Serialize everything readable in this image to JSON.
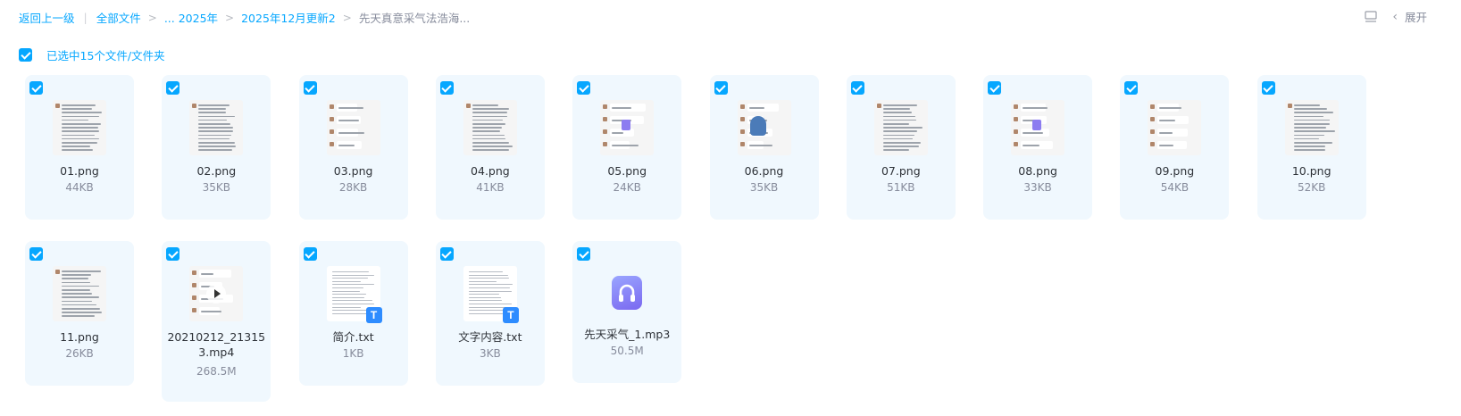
{
  "breadcrumb": {
    "back": "返回上一级",
    "items": [
      "全部文件",
      "... 2025年",
      "2025年12月更新2"
    ],
    "current": "先天真意采气法浩海..."
  },
  "toolbar": {
    "expand_label": "展开"
  },
  "selection": {
    "label": "已选中15个文件/文件夹"
  },
  "colors": {
    "accent": "#06a7ff",
    "card_bg": "#f0f8fe"
  },
  "files": [
    {
      "name": "01.png",
      "size": "44KB",
      "kind": "image",
      "checked": true
    },
    {
      "name": "02.png",
      "size": "35KB",
      "kind": "image",
      "checked": true
    },
    {
      "name": "03.png",
      "size": "28KB",
      "kind": "image",
      "checked": true
    },
    {
      "name": "04.png",
      "size": "41KB",
      "kind": "image",
      "checked": true
    },
    {
      "name": "05.png",
      "size": "24KB",
      "kind": "image",
      "checked": true
    },
    {
      "name": "06.png",
      "size": "35KB",
      "kind": "image",
      "checked": true
    },
    {
      "name": "07.png",
      "size": "51KB",
      "kind": "image",
      "checked": true
    },
    {
      "name": "08.png",
      "size": "33KB",
      "kind": "image",
      "checked": true
    },
    {
      "name": "09.png",
      "size": "54KB",
      "kind": "image",
      "checked": true
    },
    {
      "name": "10.png",
      "size": "52KB",
      "kind": "image",
      "checked": true
    },
    {
      "name": "11.png",
      "size": "26KB",
      "kind": "image",
      "checked": true
    },
    {
      "name": "20210212_213153.mp4",
      "name_lines": [
        "20210212_21315",
        "3.mp4"
      ],
      "size": "268.5M",
      "kind": "video",
      "checked": true
    },
    {
      "name": "简介.txt",
      "size": "1KB",
      "kind": "text",
      "checked": true
    },
    {
      "name": "文字内容.txt",
      "size": "3KB",
      "kind": "text",
      "checked": true
    },
    {
      "name": "先天采气_1.mp3",
      "size": "50.5M",
      "kind": "audio",
      "checked": true
    }
  ]
}
